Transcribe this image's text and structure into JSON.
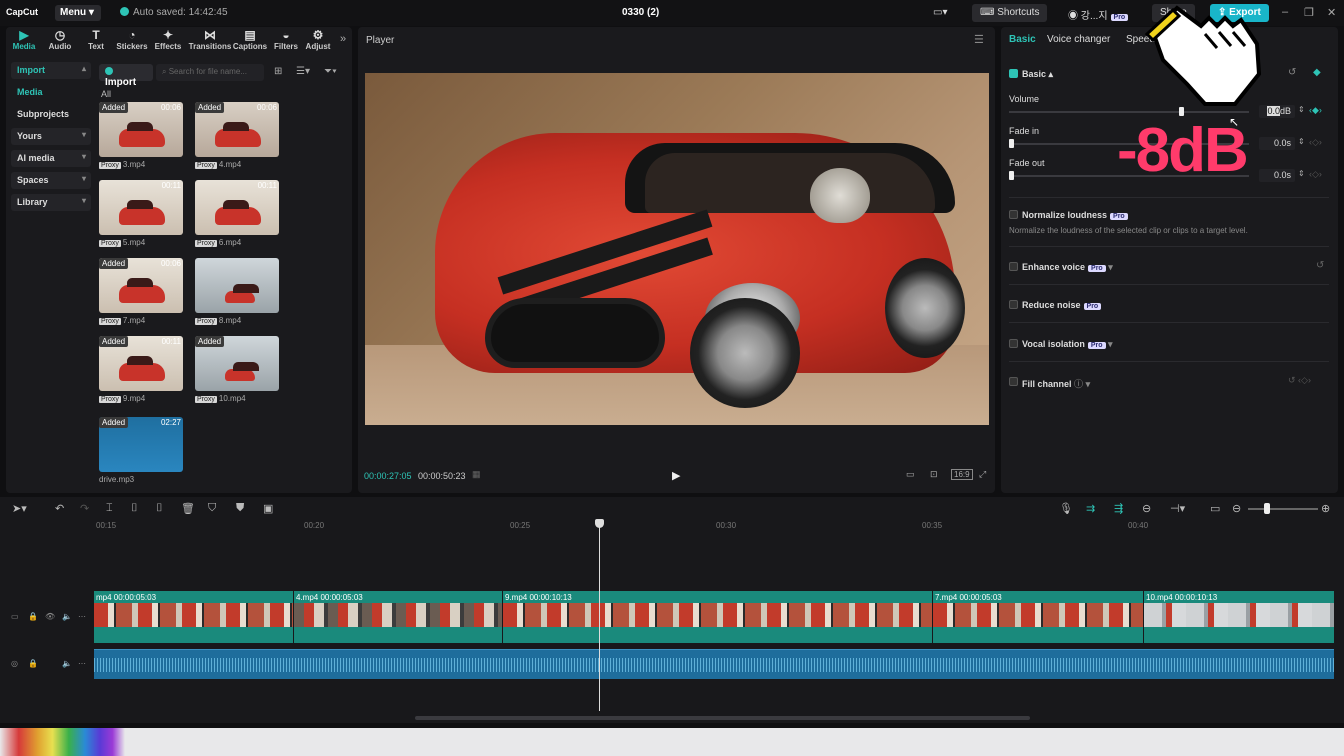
{
  "titlebar": {
    "logo": "CapCut",
    "menu": "Menu",
    "saved": "Auto saved: 14:42:45",
    "project": "0330 (2)",
    "shortcuts": "Shortcuts",
    "user": "강...지",
    "user_badge": "Pro",
    "share": "Share",
    "export": "Export"
  },
  "toolbar": [
    "Media",
    "Audio",
    "Text",
    "Stickers",
    "Effects",
    "Transitions",
    "Captions",
    "Filters",
    "Adjust"
  ],
  "toolbar_icons": [
    "▶",
    "◷",
    "T",
    "◔",
    "✦",
    "⋈",
    "▤",
    "◒",
    "⚙"
  ],
  "nav": {
    "import": "Import",
    "media": "Media",
    "subprojects": "Subprojects",
    "yours": "Yours",
    "ai_media": "AI media",
    "spaces": "Spaces",
    "library": "Library"
  },
  "media": {
    "import_btn": "Import",
    "search_placeholder": "Search for file name...",
    "all": "All",
    "items": [
      {
        "name": "3.mp4",
        "added": "Added",
        "dur": "00:06",
        "proxy": "Proxy"
      },
      {
        "name": "4.mp4",
        "added": "Added",
        "dur": "00:06",
        "proxy": "Proxy"
      },
      {
        "name": "5.mp4",
        "added": "",
        "dur": "00:11",
        "proxy": "Proxy"
      },
      {
        "name": "6.mp4",
        "added": "",
        "dur": "00:11",
        "proxy": "Proxy"
      },
      {
        "name": "7.mp4",
        "added": "Added",
        "dur": "00:06",
        "proxy": "Proxy"
      },
      {
        "name": "8.mp4",
        "added": "",
        "dur": "",
        "proxy": "Proxy"
      },
      {
        "name": "9.mp4",
        "added": "Added",
        "dur": "00:11",
        "proxy": "Proxy"
      },
      {
        "name": "10.mp4",
        "added": "Added",
        "dur": "",
        "proxy": "Proxy"
      },
      {
        "name": "drive.mp3",
        "added": "Added",
        "dur": "02:27",
        "proxy": ""
      }
    ]
  },
  "player": {
    "title": "Player",
    "current": "00:00:27:05",
    "total": "00:00:50:23",
    "ratio": "16:9"
  },
  "right": {
    "tabs": [
      "Basic",
      "Voice changer",
      "Speed"
    ],
    "section": "Basic",
    "volume_label": "Volume",
    "volume_value": "0.0",
    "volume_unit": "dB",
    "fadein_label": "Fade in",
    "fadein_value": "0.0s",
    "fadeout_label": "Fade out",
    "fadeout_value": "0.0s",
    "normalize": "Normalize loudness",
    "normalize_desc": "Normalize the loudness of the selected clip or clips to a target level.",
    "enhance": "Enhance voice",
    "reduce": "Reduce noise",
    "vocal": "Vocal isolation",
    "fill": "Fill channel",
    "pro": "Pro",
    "overlay": "-8dB"
  },
  "timeline": {
    "ticks": [
      "00:15",
      "00:20",
      "00:25",
      "00:30",
      "00:35",
      "00:40"
    ],
    "clips": [
      {
        "label": "mp4  00:00:05:03"
      },
      {
        "label": "4.mp4  00:00:05:03"
      },
      {
        "label": "9.mp4  00:00:10:13"
      },
      {
        "label": "7.mp4  00:00:05:03"
      },
      {
        "label": "10.mp4  00:00:10:13"
      }
    ]
  },
  "colors": {
    "accent": "#2ec4b6",
    "overlay": "#ff3b6b",
    "export": "#19b5c9"
  }
}
